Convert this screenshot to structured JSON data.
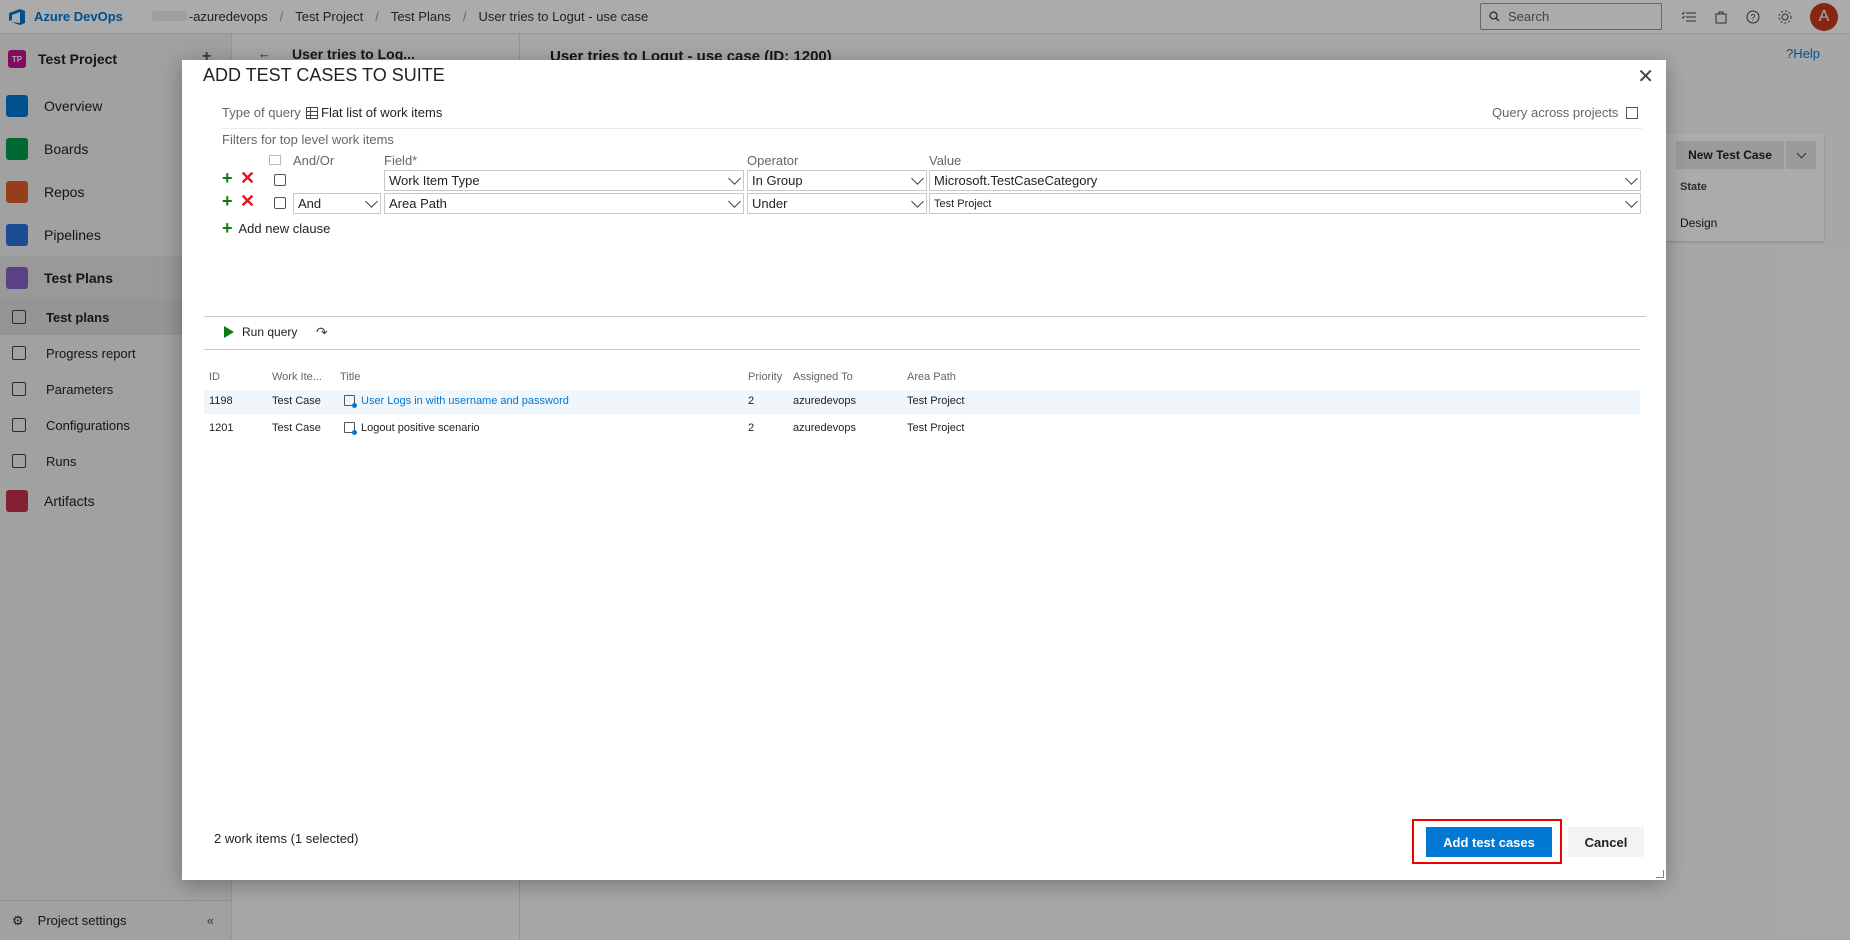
{
  "topbar": {
    "brand": "Azure DevOps",
    "org": "-azuredevops",
    "breadcrumbs": [
      "Test Project",
      "Test Plans",
      "User tries to Logut - use case"
    ],
    "search_placeholder": "Search",
    "avatar_letter": "A"
  },
  "leftnav": {
    "project_badge": "TP",
    "project_name": "Test Project",
    "items": [
      {
        "label": "Overview",
        "color": "#0078d4"
      },
      {
        "label": "Boards",
        "color": "#009b4d"
      },
      {
        "label": "Repos",
        "color": "#e05b2b"
      },
      {
        "label": "Pipelines",
        "color": "#2a6fdb"
      },
      {
        "label": "Test Plans",
        "color": "#8661c5"
      }
    ],
    "subitems": [
      "Test plans",
      "Progress report",
      "Parameters",
      "Configurations",
      "Runs"
    ],
    "artifacts": {
      "label": "Artifacts",
      "color": "#c4314b"
    },
    "settings": "Project settings"
  },
  "background": {
    "panel_title": "User tries to Log...",
    "main_title": "User tries to Logut - use case (ID: 1200)",
    "help": "?Help",
    "new_test_case": "New Test Case",
    "state_label": "State",
    "state_value": "Design"
  },
  "dialog": {
    "title": "ADD TEST CASES TO SUITE",
    "type_of_query_label": "Type of query",
    "type_of_query_value": "Flat list of work items",
    "query_across_label": "Query across projects",
    "filters_label": "Filters for top level work items",
    "headers": {
      "and_or": "And/Or",
      "field": "Field*",
      "operator": "Operator",
      "value": "Value"
    },
    "clauses": [
      {
        "and_or": "",
        "field": "Work Item Type",
        "operator": "In Group",
        "value": "Microsoft.TestCaseCategory"
      },
      {
        "and_or": "And",
        "field": "Area Path",
        "operator": "Under",
        "value": "Test Project"
      }
    ],
    "add_clause": "Add new clause",
    "run_query": "Run query",
    "columns": [
      "ID",
      "Work Ite...",
      "Title",
      "Priority",
      "Assigned To",
      "Area Path"
    ],
    "rows": [
      {
        "id": "1198",
        "type": "Test Case",
        "title": "User Logs in with username and password",
        "priority": "2",
        "assigned": "azuredevops",
        "area": "Test Project"
      },
      {
        "id": "1201",
        "type": "Test Case",
        "title": "Logout positive scenario",
        "priority": "2",
        "assigned": "azuredevops",
        "area": "Test Project"
      }
    ],
    "count_text": "2 work items (1 selected)",
    "add_button": "Add test cases",
    "cancel_button": "Cancel"
  }
}
